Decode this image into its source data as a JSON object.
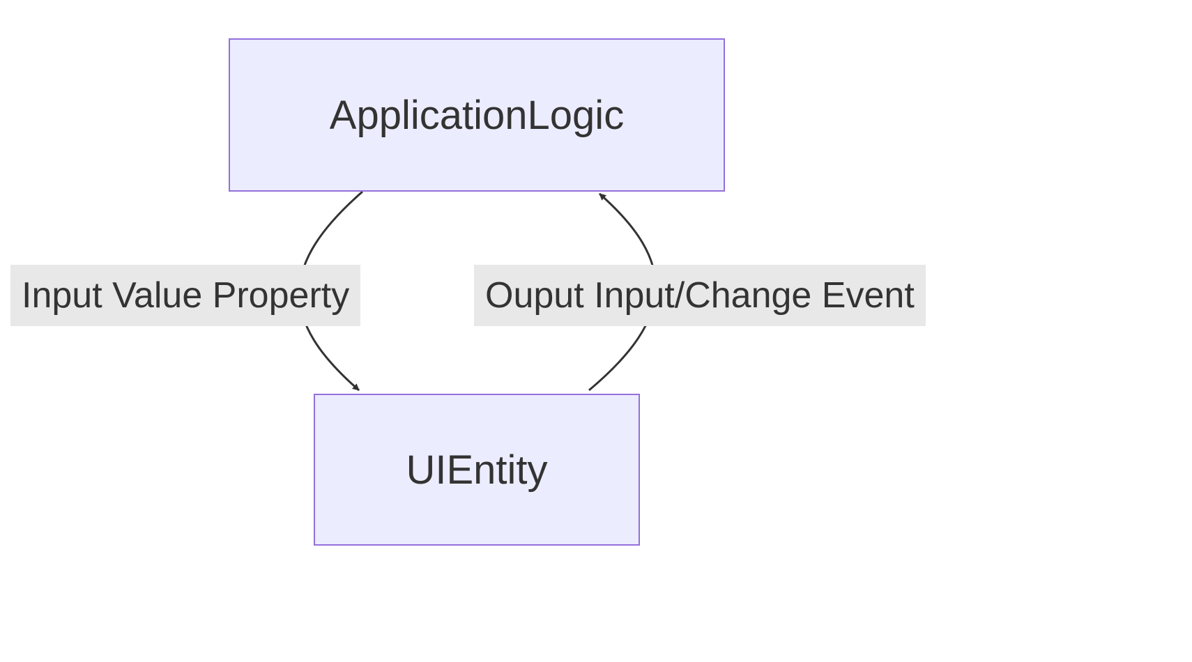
{
  "diagram": {
    "nodes": {
      "top": {
        "label": "ApplicationLogic"
      },
      "bottom": {
        "label": "UIEntity"
      }
    },
    "edges": {
      "left": {
        "label": "Input Value Property"
      },
      "right": {
        "label": "Ouput Input/Change Event"
      }
    },
    "colors": {
      "node_fill": "#ECECFF",
      "node_border": "#9370DB",
      "label_bg": "#e8e8e8",
      "text": "#333333",
      "arrow": "#333333"
    }
  }
}
